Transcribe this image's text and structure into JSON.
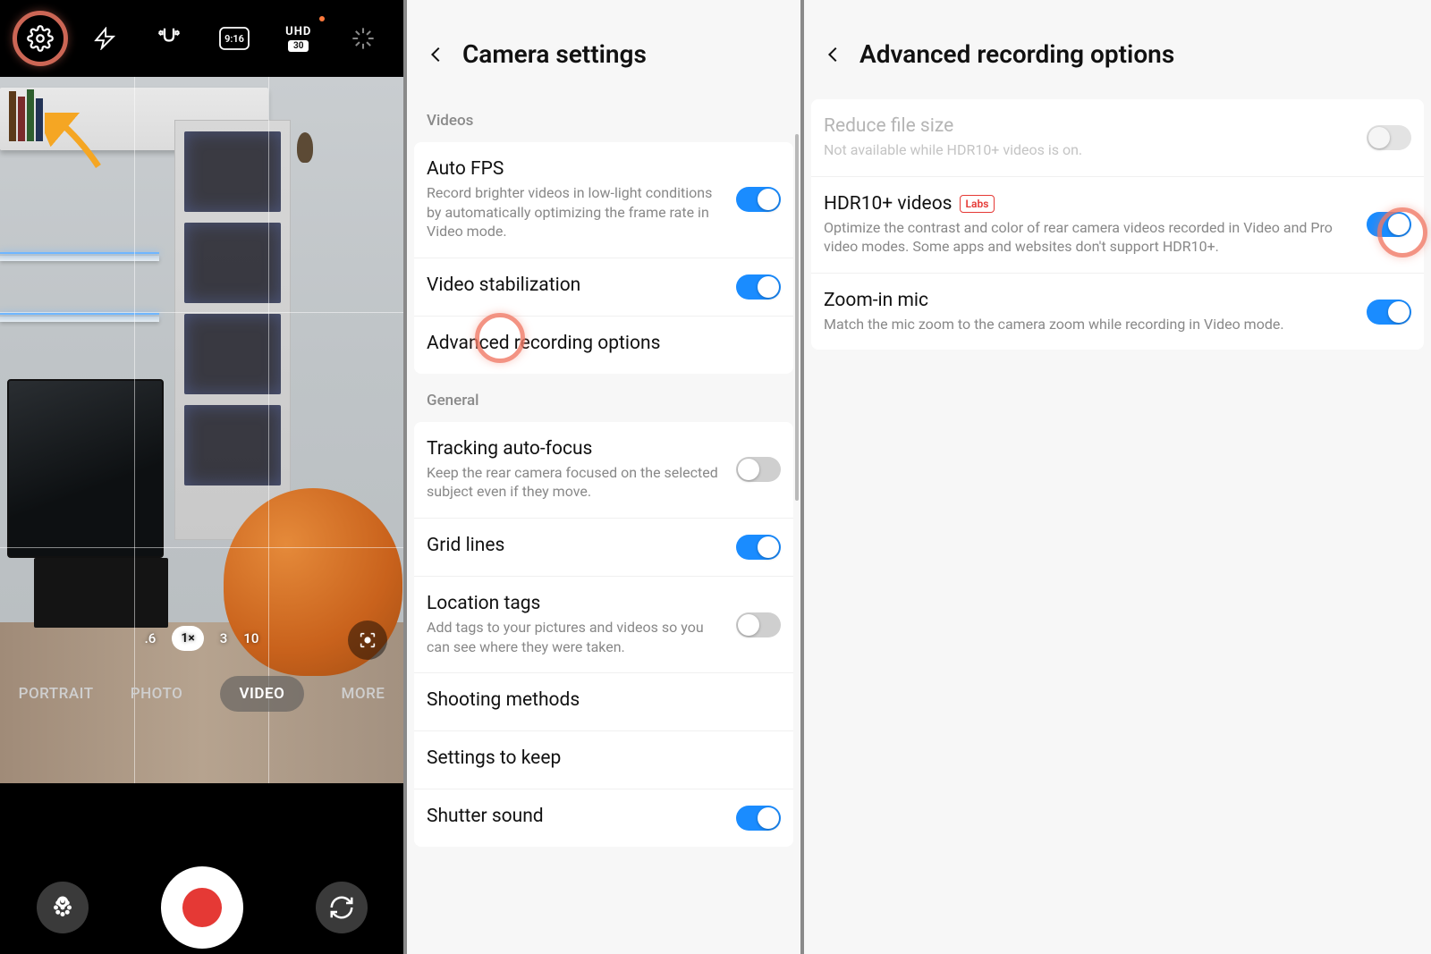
{
  "panel1": {
    "resolution_label": "UHD",
    "fps_label": "30",
    "aspect_label": "9:16",
    "zoom": {
      "levels": [
        ".6",
        "1×",
        "3",
        "10"
      ],
      "active_index": 1
    },
    "modes": [
      "PORTRAIT",
      "PHOTO",
      "VIDEO",
      "MORE"
    ],
    "active_mode_index": 2
  },
  "panel2": {
    "title": "Camera settings",
    "section_videos": "Videos",
    "section_general": "General",
    "items": {
      "auto_fps": {
        "title": "Auto FPS",
        "desc": "Record brighter videos in low-light conditions by automatically optimizing the frame rate in Video mode.",
        "on": true
      },
      "stabilization": {
        "title": "Video stabilization",
        "on": true
      },
      "adv_rec": {
        "title": "Advanced recording options"
      },
      "tracking_af": {
        "title": "Tracking auto-focus",
        "desc": "Keep the rear camera focused on the selected subject even if they move.",
        "on": false
      },
      "grid_lines": {
        "title": "Grid lines",
        "on": true
      },
      "location": {
        "title": "Location tags",
        "desc": "Add tags to your pictures and videos so you can see where they were taken.",
        "on": false
      },
      "shooting": {
        "title": "Shooting methods"
      },
      "keep": {
        "title": "Settings to keep"
      },
      "shutter": {
        "title": "Shutter sound",
        "on": true
      }
    }
  },
  "panel3": {
    "title": "Advanced recording options",
    "labs_badge": "Labs",
    "items": {
      "reduce": {
        "title": "Reduce file size",
        "desc": "Not available while HDR10+ videos is on.",
        "disabled": true
      },
      "hdr10": {
        "title": "HDR10+ videos",
        "desc": "Optimize the contrast and color of rear camera videos recorded in Video and Pro video modes. Some apps and websites don't support HDR10+.",
        "on": true
      },
      "zoom_mic": {
        "title": "Zoom-in mic",
        "desc": "Match the mic zoom to the camera zoom while recording in Video mode.",
        "on": true
      }
    }
  }
}
